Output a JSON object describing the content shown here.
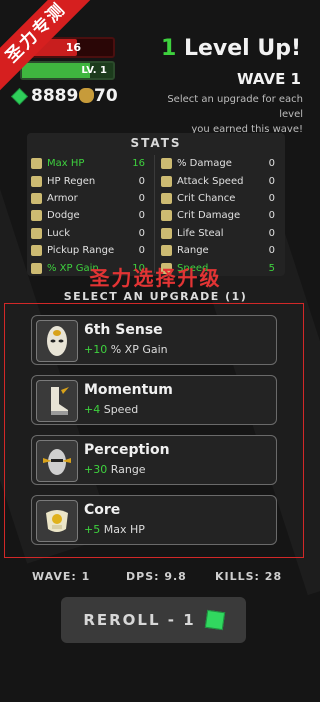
{
  "corner_ribbon": "圣力专测",
  "player": {
    "hp_text": "16",
    "hp_fraction": 0.6,
    "level_text": "LV. 1",
    "xp_fraction": 0.75,
    "gems_text": "8889",
    "gold_text": "70"
  },
  "header": {
    "level_number": "1",
    "level_label": " Level Up!",
    "wave_label": "WAVE 1",
    "hint_line1": "Select an upgrade for each level",
    "hint_line2": "you earned this wave!"
  },
  "stats": {
    "title": "STATS",
    "left": [
      {
        "label": "Max HP",
        "value": "16",
        "icon": "max-hp-icon",
        "highlight": true
      },
      {
        "label": "HP Regen",
        "value": "0",
        "icon": "hp-regen-icon",
        "highlight": false
      },
      {
        "label": "Armor",
        "value": "0",
        "icon": "armor-icon",
        "highlight": false
      },
      {
        "label": "Dodge",
        "value": "0",
        "icon": "dodge-icon",
        "highlight": false
      },
      {
        "label": "Luck",
        "value": "0",
        "icon": "luck-icon",
        "highlight": false
      },
      {
        "label": "Pickup Range",
        "value": "0",
        "icon": "pickup-range-icon",
        "highlight": false
      },
      {
        "label": "% XP Gain",
        "value": "10",
        "icon": "xp-gain-icon",
        "highlight": true
      }
    ],
    "right": [
      {
        "label": "% Damage",
        "value": "0",
        "icon": "damage-icon",
        "highlight": false
      },
      {
        "label": "Attack Speed",
        "value": "0",
        "icon": "attack-speed-icon",
        "highlight": false
      },
      {
        "label": "Crit Chance",
        "value": "0",
        "icon": "crit-chance-icon",
        "highlight": false
      },
      {
        "label": "Crit Damage",
        "value": "0",
        "icon": "crit-damage-icon",
        "highlight": false
      },
      {
        "label": "Life Steal",
        "value": "0",
        "icon": "life-steal-icon",
        "highlight": false
      },
      {
        "label": "Range",
        "value": "0",
        "icon": "range-icon",
        "highlight": false
      },
      {
        "label": "Speed",
        "value": "5",
        "icon": "speed-icon",
        "highlight": true
      }
    ]
  },
  "overlay_caption": "圣力选择升级",
  "upgrade_section_title": "SELECT AN UPGRADE (1)",
  "upgrades": [
    {
      "title": "6th Sense",
      "plus": "+10",
      "stat": " % XP Gain",
      "icon": "mask-icon"
    },
    {
      "title": "Momentum",
      "plus": "+4",
      "stat": " Speed",
      "icon": "boot-icon"
    },
    {
      "title": "Perception",
      "plus": "+30",
      "stat": " Range",
      "icon": "face-icon"
    },
    {
      "title": "Core",
      "plus": "+5",
      "stat": " Max HP",
      "icon": "chest-armor-icon"
    }
  ],
  "footer": {
    "wave": "WAVE: 1",
    "dps": "DPS: 9.8",
    "kills": "KILLS: 28",
    "reroll_label": "REROLL - 1"
  },
  "colors": {
    "accent_green": "#3ed13e",
    "hp_red": "#c81e1e",
    "highlight_box_red": "#d22828"
  }
}
